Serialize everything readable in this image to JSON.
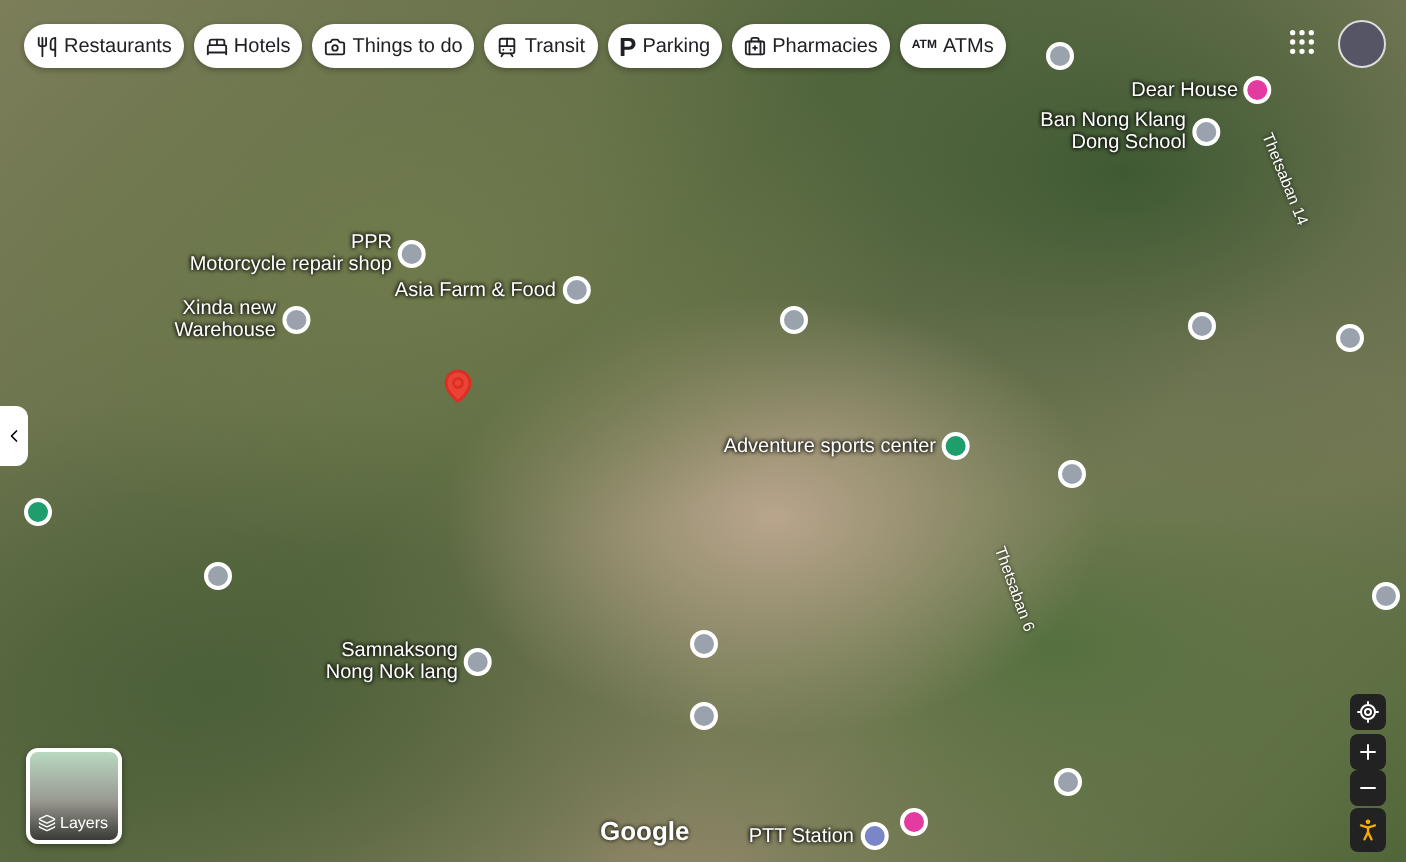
{
  "chips": [
    {
      "kind": "restaurants",
      "label": "Restaurants"
    },
    {
      "kind": "hotels",
      "label": "Hotels"
    },
    {
      "kind": "things",
      "label": "Things to do"
    },
    {
      "kind": "transit",
      "label": "Transit"
    },
    {
      "kind": "parking",
      "label": "Parking",
      "icon_text": "P"
    },
    {
      "kind": "pharmacies",
      "label": "Pharmacies"
    },
    {
      "kind": "atms",
      "label": "ATMs",
      "icon_text": "ATM"
    }
  ],
  "places": [
    {
      "lines": [
        "PPR",
        "Motorcycle repair shop"
      ],
      "color": "#9aa3ad"
    },
    {
      "lines": [
        "Asia Farm & Food"
      ],
      "color": "#9aa3ad"
    },
    {
      "lines": [
        "Xinda new",
        "Warehouse"
      ],
      "color": "#9aa3ad"
    },
    {
      "lines": [
        "Ban Nong Klang",
        "Dong School"
      ],
      "color": "#9aa3ad"
    },
    {
      "lines": [
        "Dear House"
      ],
      "color": "#e33ba0"
    },
    {
      "lines": [
        "Adventure sports center"
      ],
      "color": "#1e9e6a"
    },
    {
      "lines": [
        "Samnaksong",
        "Nong Nok lang"
      ],
      "color": "#9aa3ad"
    },
    {
      "lines": [
        "PTT Station"
      ],
      "color": "#7b86c8"
    },
    {
      "color": "#9aa3ad"
    },
    {
      "color": "#9aa3ad"
    },
    {
      "color": "#9aa3ad"
    },
    {
      "color": "#9aa3ad"
    },
    {
      "color": "#9aa3ad"
    },
    {
      "color": "#9aa3ad"
    },
    {
      "color": "#9aa3ad"
    },
    {
      "color": "#9aa3ad"
    },
    {
      "color": "#9aa3ad"
    },
    {
      "color": "#9aa3ad"
    },
    {
      "color": "#e33ba0"
    },
    {
      "color": "#1e9e6a"
    }
  ],
  "roads": [
    "Thetsaban 14",
    "Thetsaban 6"
  ],
  "layers": {
    "label": "Layers"
  },
  "logo": "Google"
}
